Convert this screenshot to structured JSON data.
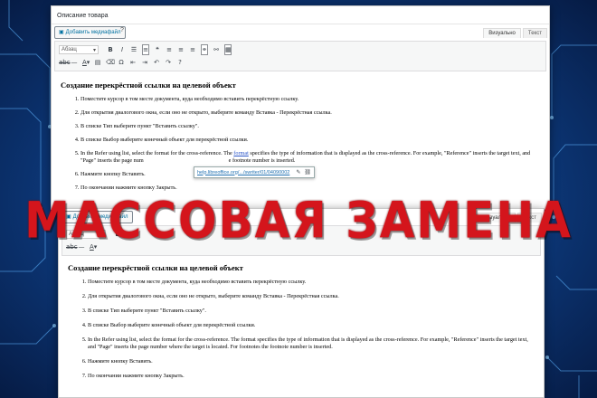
{
  "editor": {
    "title": "Описание товара",
    "add_media": "Добавить медиафайл",
    "help_icon": "?",
    "tab_visual": "Визуально",
    "tab_text": "Текст",
    "format_select": "Абзац",
    "heading": "Создание перекрёстной ссылки на целевой объект",
    "steps": [
      "Поместите курсор в том месте документа, куда необходимо вставить перекрёстную ссылку.",
      "Для открытия диалогового окна, если оно не открыто, выберите команду Вставка - Перекрёстная ссылка.",
      "В списке Тип выберите пункт \"Вставить ссылку\".",
      "В списке Выбор выберите конечный объект для перекрёстной ссылки.",
      "In the Refer using list, select the format for the cross-reference. The format specifies the type of information that is displayed as the cross-reference. For example, \"Reference\" inserts the target text, and \"Page\" inserts the page number where the target is located. For footnotes the footnote number is inserted.",
      "Нажмите кнопку Вставить.",
      "По окончании нажмите кнопку Закрыть."
    ],
    "step5_parts": {
      "before": "In the Refer using list, select the format for the cross-reference. The ",
      "link": "format",
      "after": " specifies the type of information that is displayed as the cross-reference. For example, \"Reference\" inserts the target text, and \"Page\" inserts the page num"
    },
    "step5_tail": "e footnote number is inserted.",
    "link_url": "help.libreoffice.org/.../swriter/01/04090002"
  },
  "banner": {
    "text": "МАССОВАЯ ЗАМЕНА",
    "color": "#d4151c"
  },
  "colors": {
    "background": "#0e3f86",
    "link": "#2271b1"
  }
}
